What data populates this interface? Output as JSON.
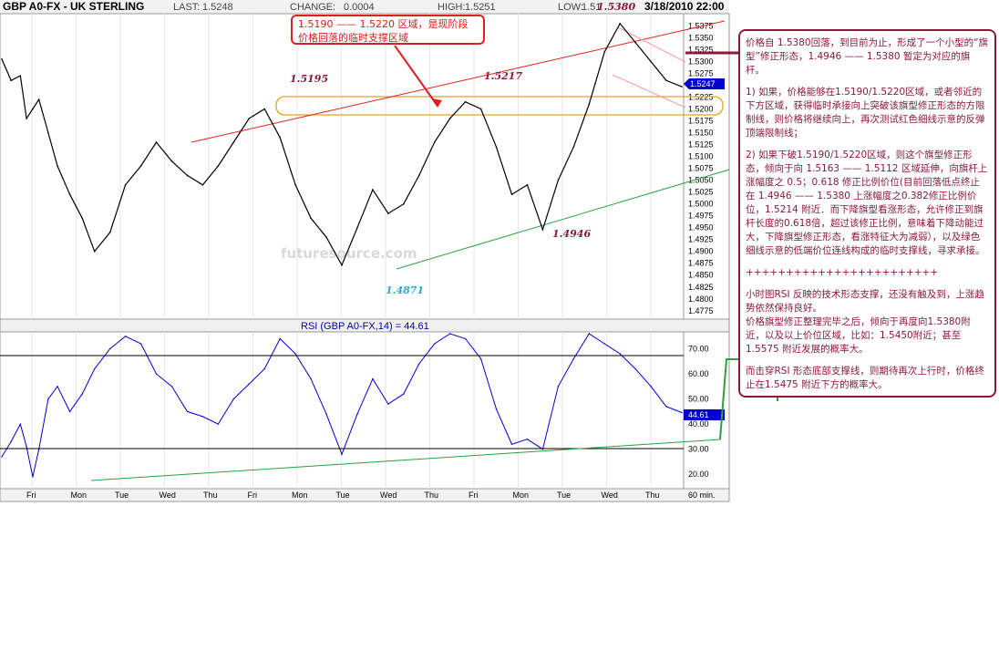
{
  "header": {
    "title": "GBP A0-FX - UK STERLING",
    "last_label": "LAST:",
    "last_value": "1.5248",
    "change_label": "CHANGE:",
    "change_value": "0.0004",
    "high_label": "HIGH:",
    "high_value": "1.5251",
    "low_label": "LOW:",
    "low_value": "1.51",
    "date": "3/18/2010 22:00"
  },
  "watermark": "futuresource.com",
  "rsi_label": "RSI (GBP A0-FX,14) = 44.61",
  "interval_label": "60 min.",
  "price_tag": "1.5247",
  "rsi_tag": "44.61",
  "callout_text": "1.5190 —— 1.5220 区域，是现阶段价格回落的临时支撑区域",
  "notes": {
    "p1": "价格自 1.5380回落，到目前为止，形成了一个小型的“旗型”修正形态，1.4946 —— 1.5380 暂定为对应的旗杆。",
    "p2": "1) 如果，价格能够在1.5190/1.5220区域，或者邻近的下方区域，获得临时承接向上突破该旗型修正形态的方限制线，则价格将继续向上，再次测试红色细线示意的反弹顶端限制线；",
    "p3": "2) 如果下破1.5190/1.5220区域，则这个旗型修正形态，倾向于向 1.5163 —— 1.5112 区域延伸，向旗杆上涨幅度之 0.5；0.618 修正比例价位(目前回落低点终止在 1.4946 —— 1.5380 上涨幅度之0.382修正比例价位，1.5214 附近．而下降旗型看涨形态，允许修正到旗杆长度的0.618倍，超过该修正比例，意味着下降动能过大，下降旗型修正形态，看涨特征大为减弱），以及绿色细线示意的低端价位连线构成的临时支撑线，寻求承接。",
    "p4": "++++++++++++++++++++++++",
    "p5": "小时图RSI 反映的技术形态支撑，还没有触及到，上涨趋势依然保持良好。",
    "p6": "价格旗型修正整理完毕之后，倾向于再度向1.5380附近，以及以上价位区域，比如：1.5450附近；甚至1.5575 附近发展的概率大。",
    "p7": "而击穿RSI 形态底部支撑线，则期待再次上行时，价格终止在1.5475 附近下方的概率大。"
  },
  "annotations": {
    "a1": "1.5195",
    "a2": "1.5217",
    "a3": "1.5380",
    "a4": "1.4946",
    "a5": "1.4871"
  },
  "colors": {
    "price_line": "#000000",
    "rsi_line": "#0000cc",
    "resistance": "#e02020",
    "support": "#2aa040",
    "zone": "#e8a020",
    "flag": "#f4a0a0",
    "notes_border": "#8b1a3a",
    "tag_bg": "#0000cc"
  },
  "chart_data": [
    {
      "type": "line",
      "title": "GBP A0-FX - UK STERLING",
      "x_axis_ticks": [
        "Fri",
        "Mon",
        "Tue",
        "Wed",
        "Thu",
        "Fri",
        "Mon",
        "Tue",
        "Wed",
        "Thu",
        "Fri",
        "Mon",
        "Tue",
        "Wed",
        "Thu"
      ],
      "y_ticks": [
        1.5375,
        1.535,
        1.5325,
        1.53,
        1.5275,
        1.525,
        1.5225,
        1.52,
        1.5175,
        1.515,
        1.5125,
        1.51,
        1.5075,
        1.505,
        1.5025,
        1.5,
        1.4975,
        1.495,
        1.4925,
        1.49,
        1.4875,
        1.485,
        1.4825,
        1.48,
        1.4775
      ],
      "ylim": [
        1.4765,
        1.5395
      ],
      "x": [
        0,
        3,
        6,
        8,
        10,
        12,
        15,
        18,
        22,
        26,
        30,
        35,
        40,
        45,
        50,
        55,
        60,
        65,
        70,
        75,
        80,
        85,
        90,
        95,
        100,
        105,
        110,
        115,
        120,
        125,
        130,
        135,
        140,
        145,
        150,
        155,
        160,
        165,
        170,
        175,
        180,
        185,
        190,
        195,
        200,
        205,
        210,
        215,
        220
      ],
      "values": [
        1.5305,
        1.526,
        1.527,
        1.518,
        1.52,
        1.522,
        1.515,
        1.508,
        1.502,
        1.497,
        1.49,
        1.494,
        1.504,
        1.508,
        1.513,
        1.509,
        1.506,
        1.504,
        1.508,
        1.513,
        1.518,
        1.52,
        1.514,
        1.504,
        1.497,
        1.493,
        1.4871,
        1.495,
        1.503,
        1.498,
        1.5,
        1.506,
        1.513,
        1.518,
        1.5215,
        1.52,
        1.512,
        1.502,
        1.504,
        1.4946,
        1.505,
        1.512,
        1.521,
        1.532,
        1.538,
        1.534,
        1.53,
        1.526,
        1.5247
      ],
      "annotations": [
        "1.5195",
        "1.5217",
        "1.5380",
        "1.4946",
        "1.4871"
      ]
    },
    {
      "type": "line",
      "title": "RSI (GBP A0-FX,14) = 44.61",
      "y_ticks": [
        70,
        60,
        50,
        40,
        30,
        20
      ],
      "ylim": [
        15,
        76
      ],
      "x": [
        0,
        3,
        6,
        8,
        10,
        12,
        15,
        18,
        22,
        26,
        30,
        35,
        40,
        45,
        50,
        55,
        60,
        65,
        70,
        75,
        80,
        85,
        90,
        95,
        100,
        105,
        110,
        115,
        120,
        125,
        130,
        135,
        140,
        145,
        150,
        155,
        160,
        165,
        170,
        175,
        180,
        185,
        190,
        195,
        200,
        205,
        210,
        215,
        220
      ],
      "values": [
        27,
        33,
        40,
        31,
        19,
        30,
        50,
        55,
        45,
        52,
        62,
        70,
        75,
        72,
        60,
        55,
        45,
        43,
        40,
        50,
        56,
        62,
        74,
        68,
        58,
        44,
        28,
        44,
        58,
        48,
        52,
        64,
        72,
        76,
        74,
        66,
        46,
        32,
        34,
        30,
        55,
        66,
        76,
        72,
        68,
        62,
        55,
        47,
        44.61
      ]
    }
  ]
}
